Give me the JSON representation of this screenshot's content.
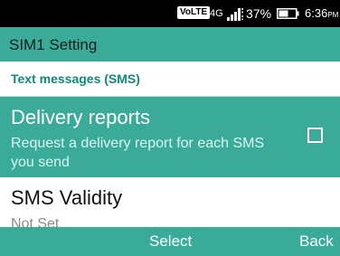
{
  "status_bar": {
    "volte": "VoLTE",
    "network": "4G",
    "battery_percent": "37%",
    "time": "6:36",
    "time_suffix": "PM",
    "icons": [
      "signal-icon",
      "battery-icon"
    ]
  },
  "header": {
    "title": "SIM1 Setting"
  },
  "section": {
    "title": "Text messages (SMS)"
  },
  "items": [
    {
      "title": "Delivery reports",
      "description": "Request a delivery report for each SMS you send",
      "checked": false
    },
    {
      "title": "SMS Validity",
      "value": "Not Set"
    }
  ],
  "softkeys": {
    "center": "Select",
    "right": "Back"
  },
  "colors": {
    "accent": "#3aab98",
    "section_text": "#0f8a7a",
    "status_bar": "#000000"
  }
}
